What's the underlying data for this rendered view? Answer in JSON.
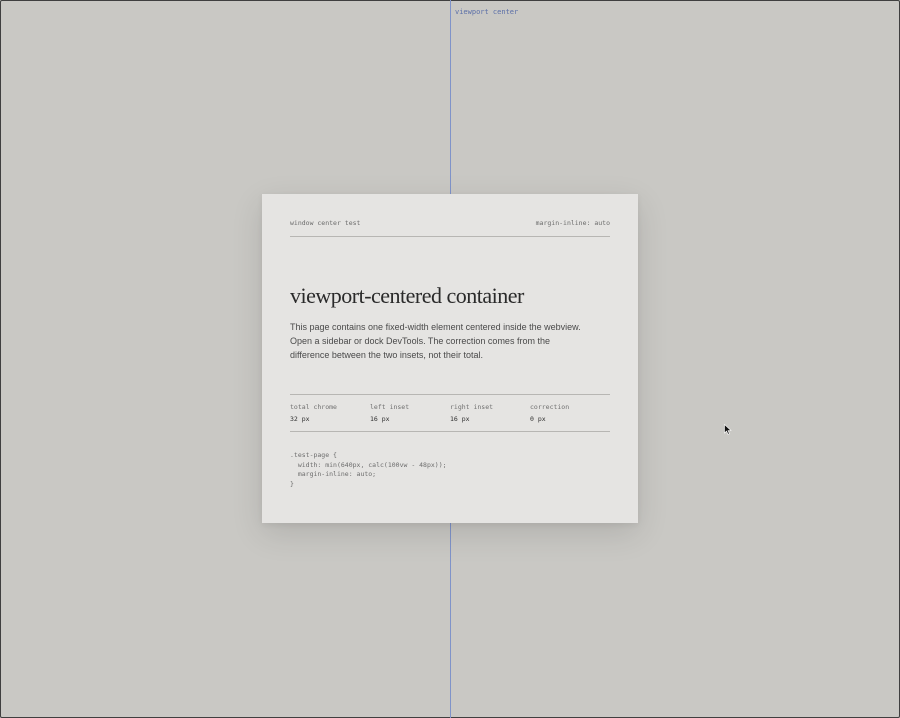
{
  "guide": {
    "label": "viewport center",
    "color": "#7f93c9"
  },
  "card": {
    "header_left": "window center test",
    "header_right": "margin-inline: auto",
    "title": "viewport-centered container",
    "description": "This page contains one fixed-width element centered inside the webview. Open a sidebar or dock DevTools. The correction comes from the difference between the two insets, not their total.",
    "stats": [
      {
        "label": "total chrome",
        "value": "32 px"
      },
      {
        "label": "left inset",
        "value": "16 px"
      },
      {
        "label": "right inset",
        "value": "16 px"
      },
      {
        "label": "correction",
        "value": "0 px"
      }
    ],
    "code": ".test-page {\n  width: min(640px, calc(100vw - 48px));\n  margin-inline: auto;\n}"
  },
  "colors": {
    "background": "#c9c8c4",
    "card": "#e5e4e2",
    "text": "#2a2a2a"
  },
  "icons": {
    "cursor": "mouse-pointer-icon"
  }
}
